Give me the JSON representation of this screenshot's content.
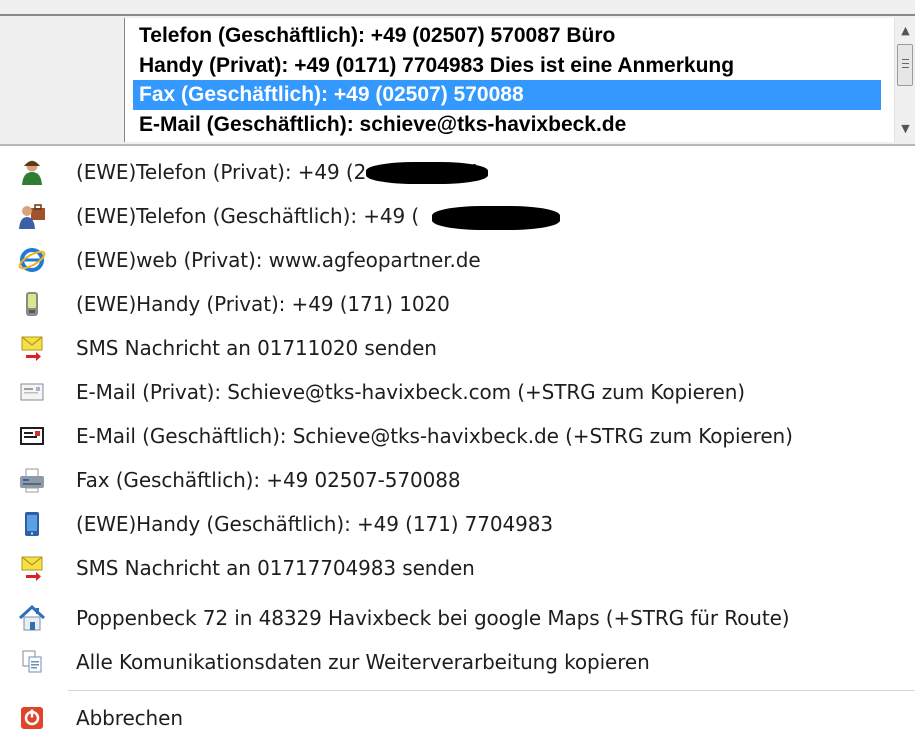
{
  "listbox": {
    "items": [
      "Telefon (Geschäftlich): +49 (02507) 570087 Büro",
      "Handy (Privat): +49 (0171) 7704983 Dies ist eine Anmerkung",
      "Fax (Geschäftlich): +49 (02507) 570088",
      "E-Mail (Geschäftlich): schieve@tks-havixbeck.de"
    ],
    "selected": "Fax (Geschäftlich): +49 (02507) 570088"
  },
  "menu": {
    "items": [
      {
        "label": "(EWE)Telefon (Privat): +49 (2",
        "suffix": "4",
        "icon": "person-icon"
      },
      {
        "label": "(EWE)Telefon (Geschäftlich): +49 (",
        "suffix": "",
        "icon": "business-person-icon"
      },
      {
        "label": "(EWE)web (Privat): www.agfeopartner.de",
        "icon": "internet-explorer-icon"
      },
      {
        "label": "(EWE)Handy (Privat): +49 (171) 1020",
        "icon": "mobile-phone-icon"
      },
      {
        "label": "SMS Nachricht an 01711020 senden",
        "icon": "sms-envelope-icon"
      },
      {
        "label": "E-Mail (Privat): Schieve@tks-havixbeck.com (+STRG zum Kopieren)",
        "icon": "email-card-icon"
      },
      {
        "label": "E-Mail (Geschäftlich): Schieve@tks-havixbeck.de (+STRG zum Kopieren)",
        "icon": "email-card-dark-icon"
      },
      {
        "label": "Fax (Geschäftlich): +49 02507-570088",
        "icon": "fax-icon"
      },
      {
        "label": "(EWE)Handy (Geschäftlich): +49 (171) 7704983",
        "icon": "smartphone-icon"
      },
      {
        "label": "SMS Nachricht an 01717704983 senden",
        "icon": "sms-envelope-icon"
      },
      {
        "label": "Poppenbeck 72 in 48329 Havixbeck bei google Maps (+STRG für Route)",
        "icon": "home-icon"
      },
      {
        "label": "Alle Komunikationsdaten zur Weiterverarbeitung kopieren",
        "icon": "copy-icon"
      },
      {
        "label": "Abbrechen",
        "icon": "cancel-icon"
      }
    ]
  },
  "colors": {
    "selection": "#3399ff",
    "menu_text": "#1e1e1e",
    "cancel_red": "#e0452b"
  }
}
